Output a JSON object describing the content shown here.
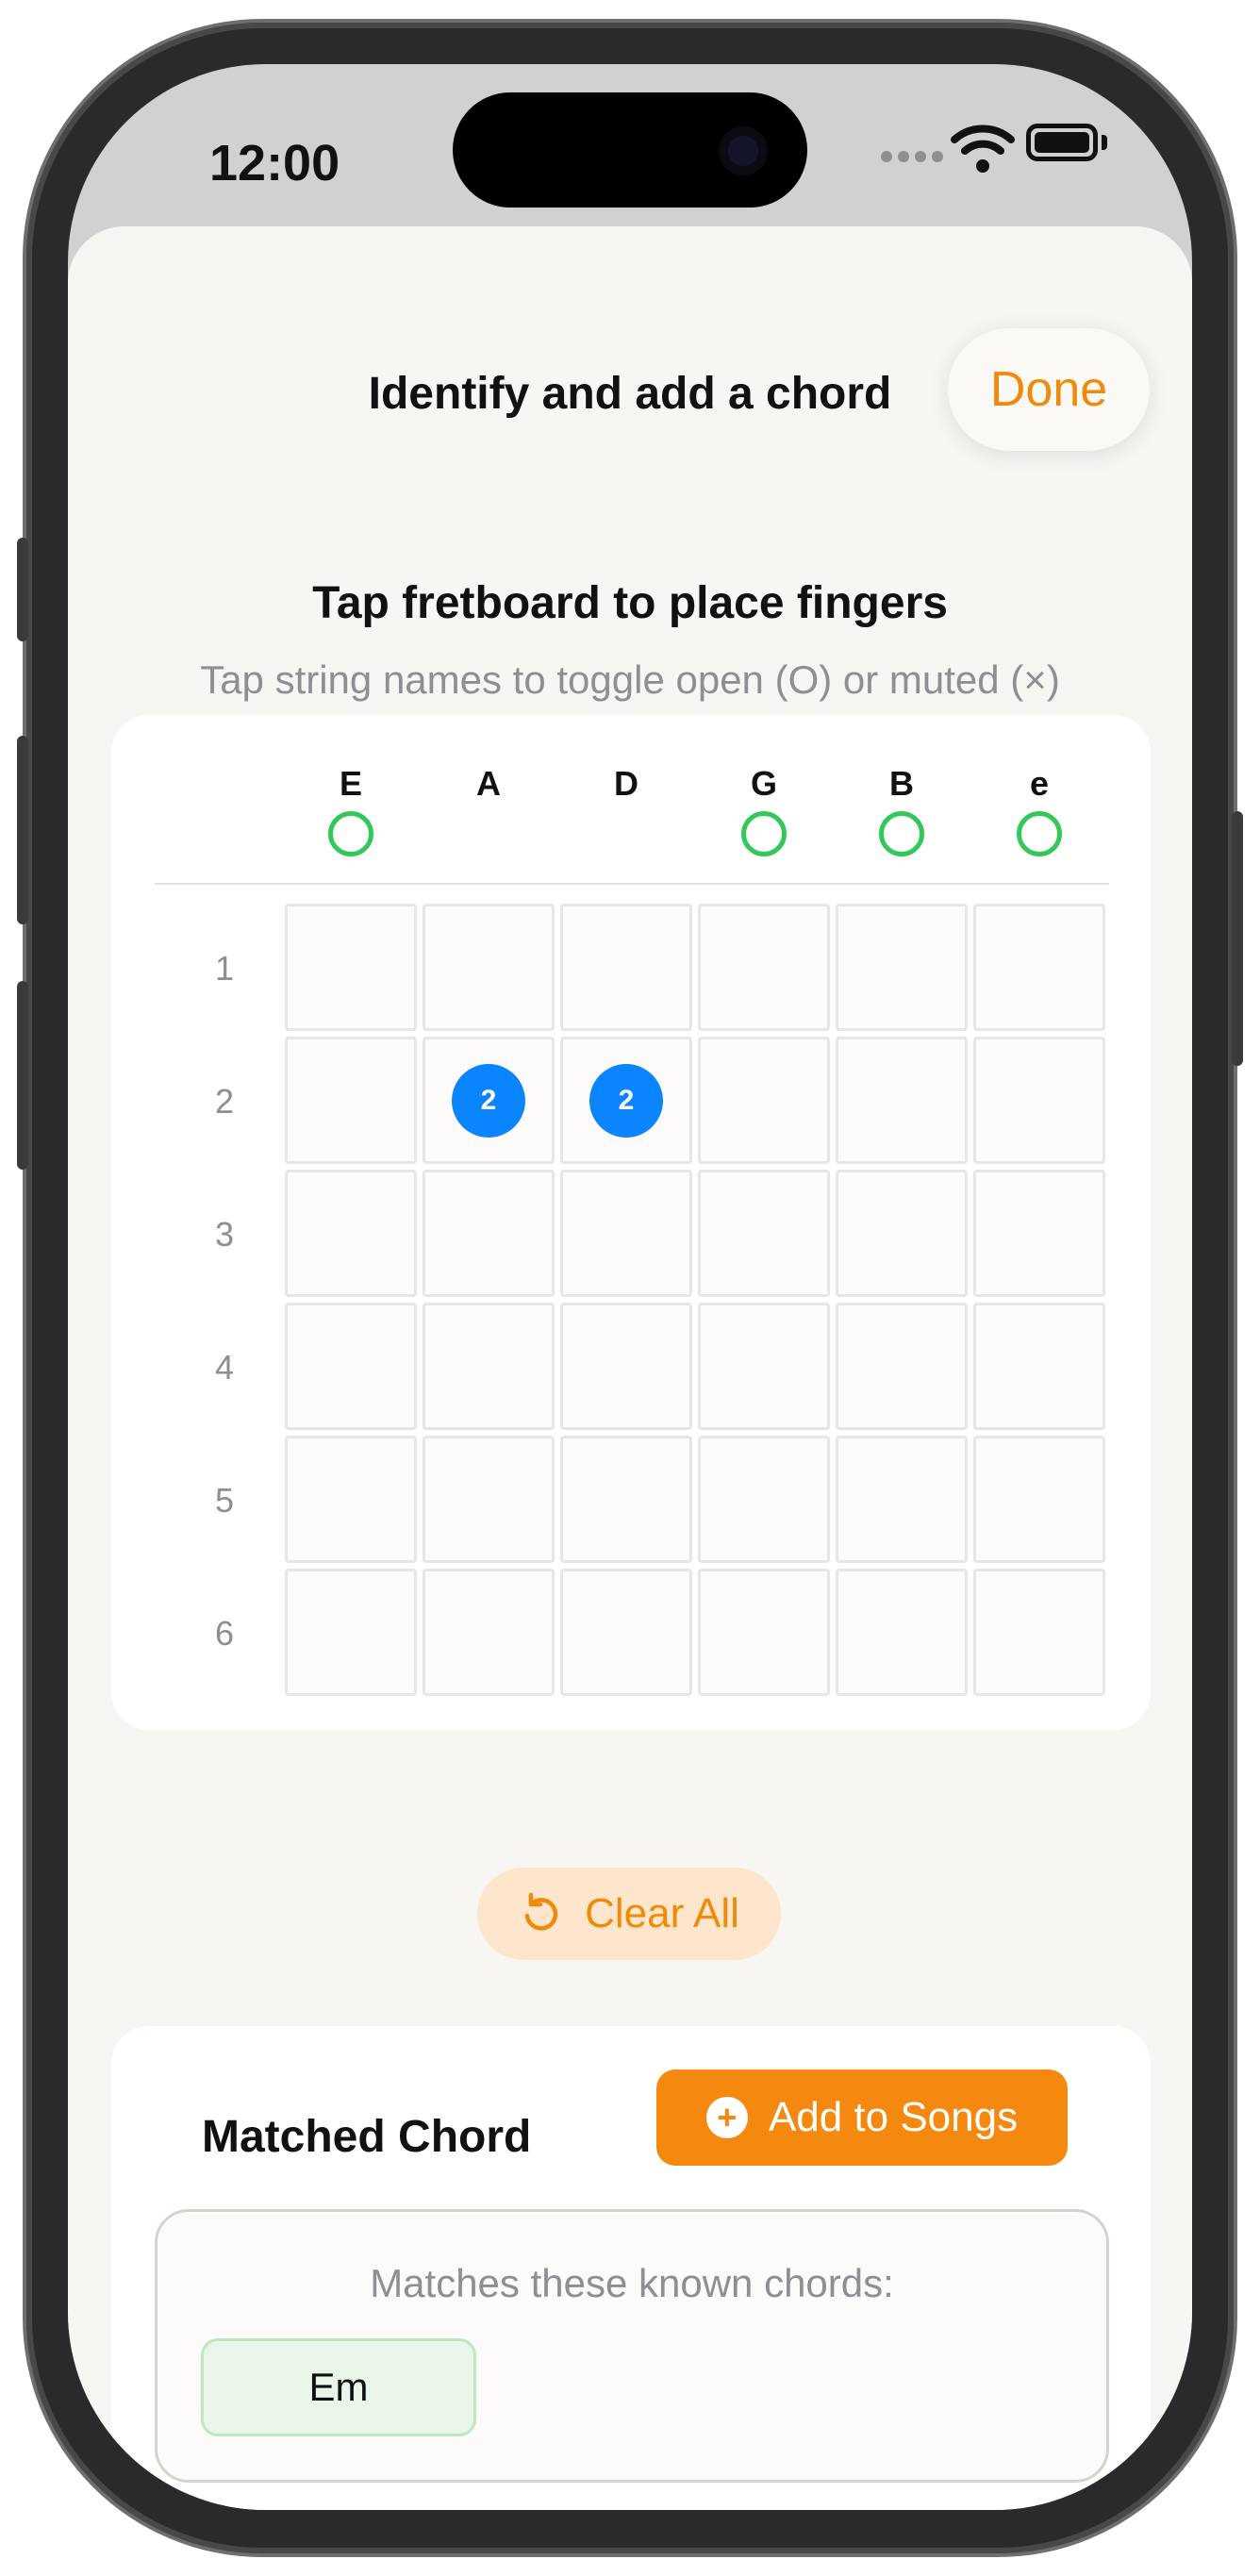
{
  "status_bar": {
    "time": "12:00"
  },
  "header": {
    "title": "Identify and add a chord",
    "done_label": "Done"
  },
  "instructions": {
    "title": "Tap fretboard to place fingers",
    "subtitle": "Tap string names to toggle open (O) or muted (×)"
  },
  "fretboard": {
    "strings": [
      {
        "name": "E",
        "state": "open"
      },
      {
        "name": "A",
        "state": "none"
      },
      {
        "name": "D",
        "state": "none"
      },
      {
        "name": "G",
        "state": "open"
      },
      {
        "name": "B",
        "state": "open"
      },
      {
        "name": "e",
        "state": "open"
      }
    ],
    "frets": [
      "1",
      "2",
      "3",
      "4",
      "5",
      "6"
    ],
    "fingers": [
      {
        "string": 1,
        "fret": 2,
        "label": "2"
      },
      {
        "string": 2,
        "fret": 2,
        "label": "2"
      }
    ],
    "open_color": "#34c759",
    "finger_color": "#0a84ff"
  },
  "clear_button": {
    "label": "Clear All",
    "icon": "undo-icon"
  },
  "matched": {
    "title": "Matched Chord",
    "add_label": "Add to Songs",
    "add_icon": "plus-circle-icon",
    "known_label": "Matches these known chords:",
    "chords": [
      "Em"
    ]
  },
  "colors": {
    "accent": "#f08a0a",
    "sheet_background": "#f8f6f3"
  }
}
